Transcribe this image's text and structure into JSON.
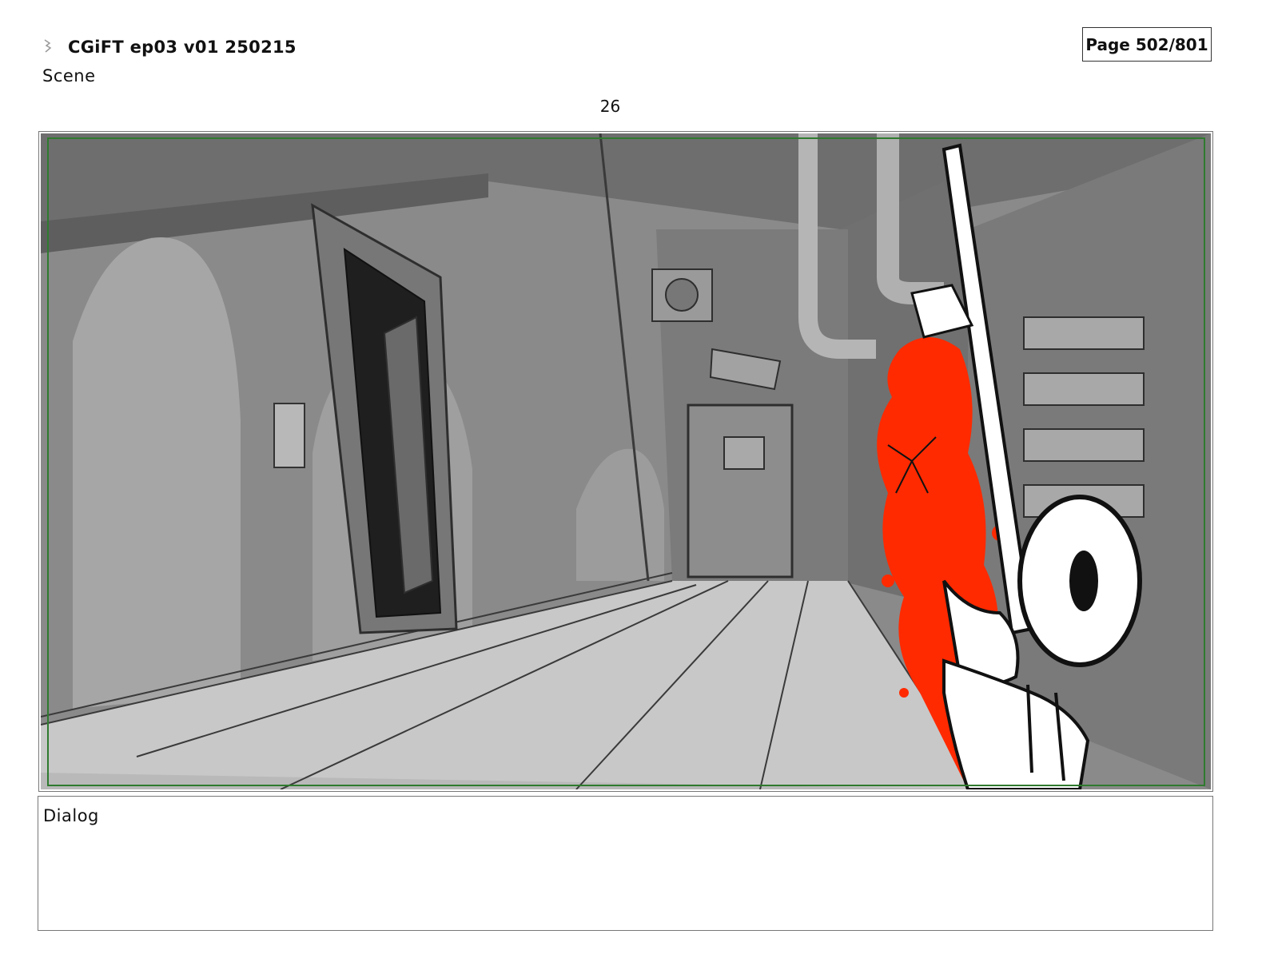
{
  "header": {
    "title": "CGiFT ep03 v01 250215",
    "page": "Page 502/801",
    "logo_icon": "storyboard-logo-icon"
  },
  "scene": {
    "label": "Scene",
    "panel_number": "26"
  },
  "panel": {
    "icon": "storyboard-frame-illustration",
    "accent_color": "#ff2a00",
    "safe_frame_color": "#2f7a2f"
  },
  "dialog": {
    "label": "Dialog",
    "text": ""
  }
}
